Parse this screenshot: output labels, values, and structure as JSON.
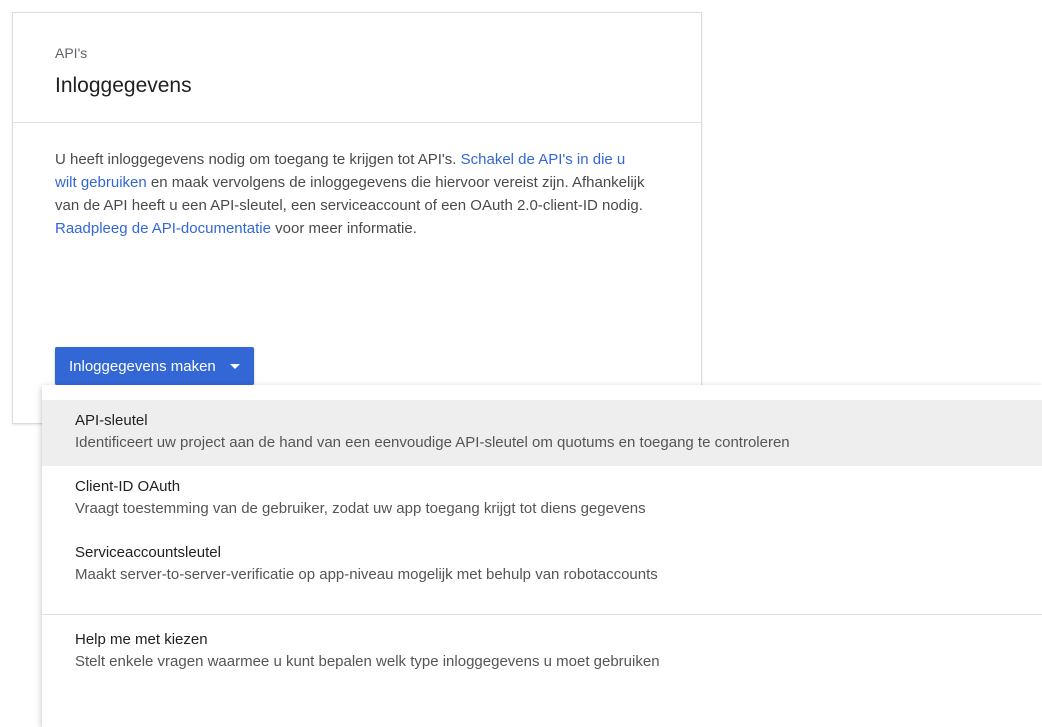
{
  "header": {
    "breadcrumb": "API's",
    "title": "Inloggegevens"
  },
  "body": {
    "text_1": "U heeft inloggegevens nodig om toegang te krijgen tot API's. ",
    "link_enable_apis": "Schakel de API's in die u wilt gebruiken",
    "text_2": " en maak vervolgens de inloggegevens die hiervoor vereist zijn. Afhankelijk van de API heeft u een API-sleutel, een serviceaccount of een OAuth 2.0-client-ID nodig. ",
    "link_docs": "Raadpleeg de API-documentatie",
    "text_3": " voor meer informatie."
  },
  "create_button": {
    "label": "Inloggegevens maken",
    "icon": "caret-down-icon",
    "color": "#3367d6"
  },
  "menu": {
    "items": [
      {
        "title": "API-sleutel",
        "description": "Identificeert uw project aan de hand van een eenvoudige API-sleutel om quotums en toegang te controleren",
        "highlighted": true
      },
      {
        "title": "Client-ID OAuth",
        "description": "Vraagt toestemming van de gebruiker, zodat uw app toegang krijgt tot diens gegevens",
        "highlighted": false
      },
      {
        "title": "Serviceaccountsleutel",
        "description": "Maakt server-to-server-verificatie op app-niveau mogelijk met behulp van robotaccounts",
        "highlighted": false
      }
    ],
    "help_item": {
      "title": "Help me met kiezen",
      "description": "Stelt enkele vragen waarmee u kunt bepalen welk type inloggegevens u moet gebruiken"
    }
  },
  "colors": {
    "link": "#3367d6",
    "highlight": "#eeeeee"
  }
}
